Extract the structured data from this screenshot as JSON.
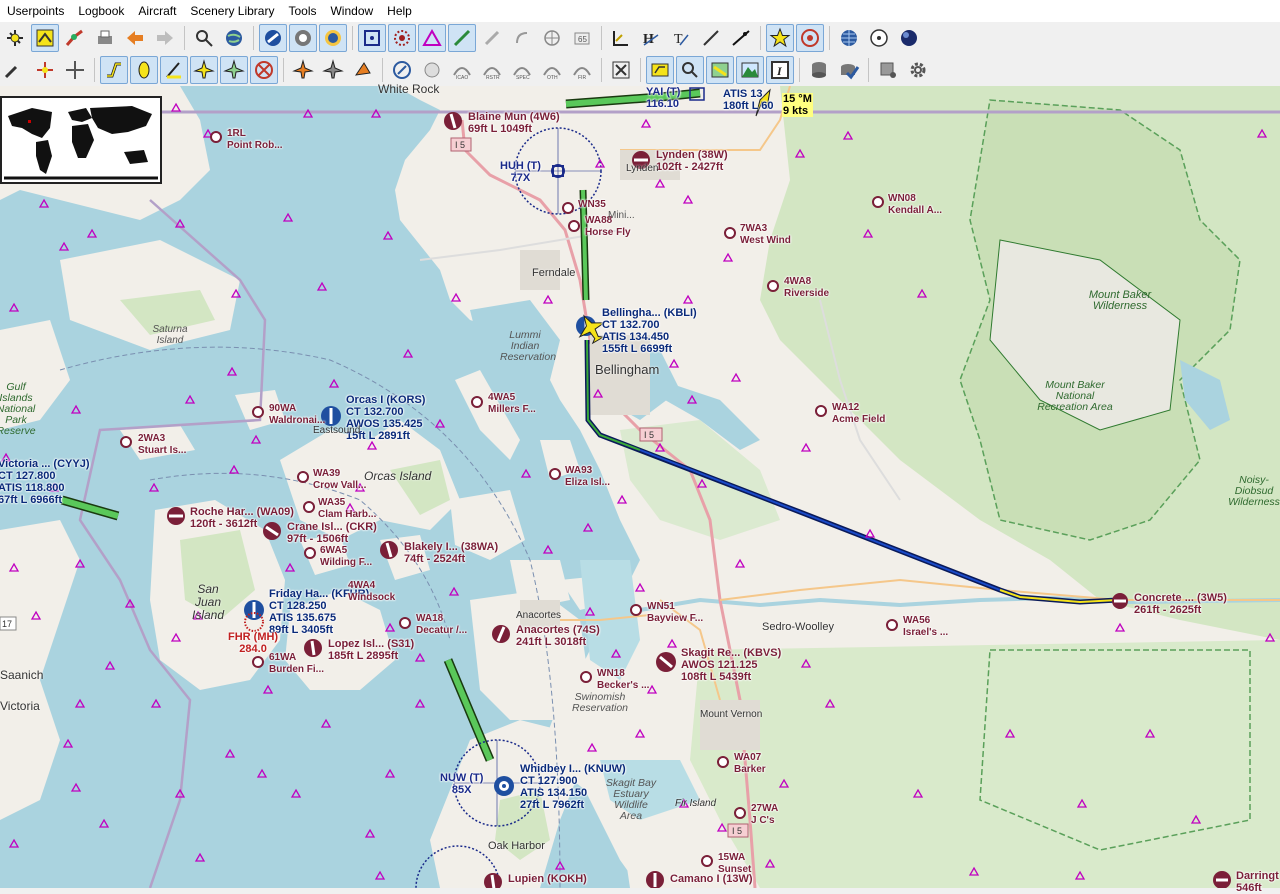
{
  "menu": [
    "Userpoints",
    "Logbook",
    "Aircraft",
    "Scenery Library",
    "Tools",
    "Window",
    "Help"
  ],
  "toolbar1_icons": [
    "flightplan-new-icon",
    "flightplan-open-icon",
    "flightplan-route-icon",
    "print-icon",
    "back-icon",
    "forward-icon",
    "search-icon",
    "globe-icon",
    "airport-icon",
    "vor-icon",
    "ndb-icon",
    "waypoint-icon",
    "vor-radial-icon",
    "airway-icon",
    "user-point-icon",
    "measure-icon",
    "range-ring-icon",
    "ils-icon",
    "terrain-icon",
    "track-icon",
    "heading-icon",
    "star-icon",
    "target-icon",
    "grid-icon",
    "compass-icon",
    "sphere-icon"
  ],
  "toolbar2_icons": [
    "aircraft-trail-icon",
    "compass-rose-icon",
    "center-aircraft-icon",
    "route-line-icon",
    "highlight-icon",
    "distance-icon",
    "airplane-icon",
    "ai-aircraft-icon",
    "wind-icon",
    "user-aircraft-icon",
    "helicopter-icon",
    "ship-icon",
    "airspace-icon",
    "airspace-sfc-icon",
    "icao-airspace-icon",
    "restricted-icon",
    "special-icon",
    "other-icon",
    "fir-icon",
    "close-icon",
    "label-icon",
    "zoom-icon",
    "scenery-icon",
    "mountain-icon",
    "info-icon",
    "database-icon",
    "check-icon",
    "export-icon",
    "gear-icon"
  ],
  "airports": [
    {
      "name": "Blaine Mun (4W6)",
      "info": "69ft L 1049ft"
    },
    {
      "name": "Lynden (38W)",
      "info": "102ft - 2427ft"
    },
    {
      "name": "Bellingha... (KBLI)",
      "ct": "CT 132.700",
      "atis": "ATIS 134.450",
      "info": "155ft L 6699ft"
    },
    {
      "name": "Orcas I (KORS)",
      "ct": "CT 132.700",
      "atis": "AWOS 135.425",
      "info": "15ft L 2891ft"
    },
    {
      "name": "Roche Har... (WA09)",
      "info": "120ft - 3612ft"
    },
    {
      "name": "Crane Isl... (CKR)",
      "info": "97ft - 1506ft"
    },
    {
      "name": "Blakely I... (38WA)",
      "info": "74ft - 2524ft"
    },
    {
      "name": "Friday Ha... (KFHR)",
      "ct": "CT 128.250",
      "atis": "ATIS 135.675",
      "info": "89ft L 3405ft"
    },
    {
      "name": "Lopez Isl... (S31)",
      "info": "185ft L 2895ft"
    },
    {
      "name": "Anacortes (74S)",
      "info": "241ft L 3018ft"
    },
    {
      "name": "Skagit Re... (KBVS)",
      "atis": "AWOS 121.125",
      "info": "108ft L 5439ft"
    },
    {
      "name": "Concrete ... (3W5)",
      "info": "261ft - 2625ft"
    },
    {
      "name": "Whidbey I... (KNUW)",
      "ct": "CT 127.900",
      "atis": "ATIS 134.150",
      "info": "27ft L 7962ft"
    },
    {
      "name": "Victoria ... (CYYJ)",
      "ct": "CT 127.800",
      "atis": "ATIS 118.800",
      "info": "67ft L 6966ft"
    },
    {
      "name": "Camano I (13W)"
    },
    {
      "name": "Lupien (KOKH)"
    }
  ],
  "small_fields": [
    {
      "id": "1RL",
      "name": "Point Rob..."
    },
    {
      "id": "WN35",
      "name": ""
    },
    {
      "id": "WA88",
      "name": "Horse Fly"
    },
    {
      "id": "7WA3",
      "name": "West Wind"
    },
    {
      "id": "WN08",
      "name": "Kendall A..."
    },
    {
      "id": "4WA8",
      "name": "Riverside"
    },
    {
      "id": "4WA5",
      "name": "Millers F..."
    },
    {
      "id": "WA12",
      "name": "Acme Field"
    },
    {
      "id": "WA93",
      "name": "Eliza Isl..."
    },
    {
      "id": "90WA",
      "name": "Waldronai..."
    },
    {
      "id": "2WA3",
      "name": "Stuart Is..."
    },
    {
      "id": "WA39",
      "name": "Crow Vall..."
    },
    {
      "id": "WA35",
      "name": "Clam Harb..."
    },
    {
      "id": "6WA5",
      "name": "Wilding F..."
    },
    {
      "id": "4WA4",
      "name": "Windsock"
    },
    {
      "id": "WA18",
      "name": "Decatur /..."
    },
    {
      "id": "61WA",
      "name": "Burden Fi..."
    },
    {
      "id": "WN51",
      "name": "Bayview F..."
    },
    {
      "id": "WN18",
      "name": "Becker's ..."
    },
    {
      "id": "WA56",
      "name": "Israel's ..."
    },
    {
      "id": "WA07",
      "name": "Barker"
    },
    {
      "id": "27WA",
      "name": "J C's"
    },
    {
      "id": "15WA",
      "name": "Sunset"
    },
    {
      "id": "Darringt",
      "name": "546ft"
    }
  ],
  "navaids": [
    {
      "name": "HUH (T)",
      "freq": "77X"
    },
    {
      "name": "NUW (T)",
      "freq": "85X"
    },
    {
      "name": "FHR (MH)",
      "freq": "284.0"
    },
    {
      "name": "YAI (T)",
      "freq": "116.10"
    }
  ],
  "atis_fragment": {
    "a": "ATIS 13",
    "b": "180ft L 60"
  },
  "wind": {
    "dir": "15 °M",
    "speed": "9 kts"
  },
  "towns": [
    "White Rock",
    "Lynden",
    "Ferndale",
    "Bellingham",
    "Eastsound",
    "Orcas Island",
    "San Juan Island",
    "Anacortes",
    "Sedro-Woolley",
    "Mount Vernon",
    "Fir Island",
    "Oak Harbor",
    "Victoria",
    "Saanich",
    "Saturna Island"
  ],
  "regions": [
    "Lummi Indian Reservation",
    "Swinomish Reservation",
    "Skagit Bay Estuary Wildlife Area",
    "Mount Baker Wilderness",
    "Mount Baker National Recreation Area",
    "Noisy-Diobsud Wilderness",
    "Gulf Islands National Park Reserve",
    "Mini..."
  ],
  "road_shields": [
    "I 5",
    "17"
  ],
  "colors": {
    "water": "#aad3df",
    "land": "#f2efe9",
    "forest": "#d3e6c3",
    "park_border": "#4a9a4a",
    "route": "#0a1a8a",
    "aircraft": "#f5e31a",
    "airport": "#7a1f38",
    "navaid": "#1a2a8a"
  }
}
